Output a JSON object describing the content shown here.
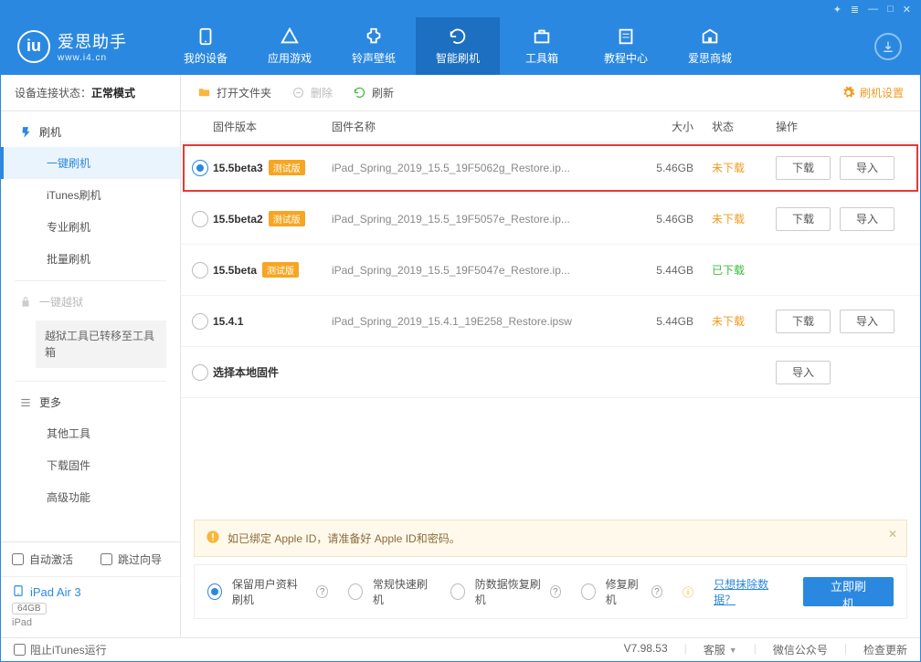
{
  "brand": {
    "name": "爱思助手",
    "url": "www.i4.cn",
    "logo_letter": "iu"
  },
  "top_tabs": [
    {
      "label": "我的设备"
    },
    {
      "label": "应用游戏"
    },
    {
      "label": "铃声壁纸"
    },
    {
      "label": "智能刷机",
      "active": true
    },
    {
      "label": "工具箱"
    },
    {
      "label": "教程中心"
    },
    {
      "label": "爱思商城"
    }
  ],
  "sidebar": {
    "status_label": "设备连接状态：",
    "status_value": "正常模式",
    "flash_title": "刷机",
    "flash_items": [
      {
        "label": "一键刷机",
        "active": true
      },
      {
        "label": "iTunes刷机"
      },
      {
        "label": "专业刷机"
      },
      {
        "label": "批量刷机"
      }
    ],
    "jailbreak_title": "一键越狱",
    "jailbreak_note": "越狱工具已转移至工具箱",
    "more_title": "更多",
    "more_items": [
      {
        "label": "其他工具"
      },
      {
        "label": "下载固件"
      },
      {
        "label": "高级功能"
      }
    ],
    "auto_activate": "自动激活",
    "skip_guide": "跳过向导",
    "device": {
      "name": "iPad Air 3",
      "storage": "64GB",
      "type": "iPad"
    }
  },
  "toolbar": {
    "open": "打开文件夹",
    "delete": "删除",
    "refresh": "刷新",
    "settings": "刷机设置"
  },
  "columns": {
    "version": "固件版本",
    "name": "固件名称",
    "size": "大小",
    "status": "状态",
    "action": "操作"
  },
  "rows": [
    {
      "version": "15.5beta3",
      "beta": true,
      "name": "iPad_Spring_2019_15.5_19F5062g_Restore.ip...",
      "size": "5.46GB",
      "status": "未下载",
      "status_class": "st-not",
      "download": true,
      "import": true,
      "selected": true,
      "highlight": true
    },
    {
      "version": "15.5beta2",
      "beta": true,
      "name": "iPad_Spring_2019_15.5_19F5057e_Restore.ip...",
      "size": "5.46GB",
      "status": "未下载",
      "status_class": "st-not",
      "download": true,
      "import": true
    },
    {
      "version": "15.5beta",
      "beta": true,
      "name": "iPad_Spring_2019_15.5_19F5047e_Restore.ip...",
      "size": "5.44GB",
      "status": "已下载",
      "status_class": "st-done",
      "download": false,
      "import": false
    },
    {
      "version": "15.4.1",
      "beta": false,
      "name": "iPad_Spring_2019_15.4.1_19E258_Restore.ipsw",
      "size": "5.44GB",
      "status": "未下载",
      "status_class": "st-not",
      "download": true,
      "import": true
    },
    {
      "version": "选择本地固件",
      "beta": false,
      "local": true,
      "import": true
    }
  ],
  "buttons": {
    "download": "下载",
    "import": "导入"
  },
  "beta_tag": "测试版",
  "notice": "如已绑定 Apple ID，请准备好 Apple ID和密码。",
  "flash_modes": [
    {
      "label": "保留用户资料刷机",
      "checked": true,
      "help": true
    },
    {
      "label": "常规快速刷机"
    },
    {
      "label": "防数据恢复刷机",
      "help": true
    },
    {
      "label": "修复刷机",
      "help": true
    }
  ],
  "erase_link": "只想抹除数据？",
  "flash_now": "立即刷机",
  "footer": {
    "block_itunes": "阻止iTunes运行",
    "version": "V7.98.53",
    "support": "客服",
    "wechat": "微信公众号",
    "update": "检查更新"
  }
}
